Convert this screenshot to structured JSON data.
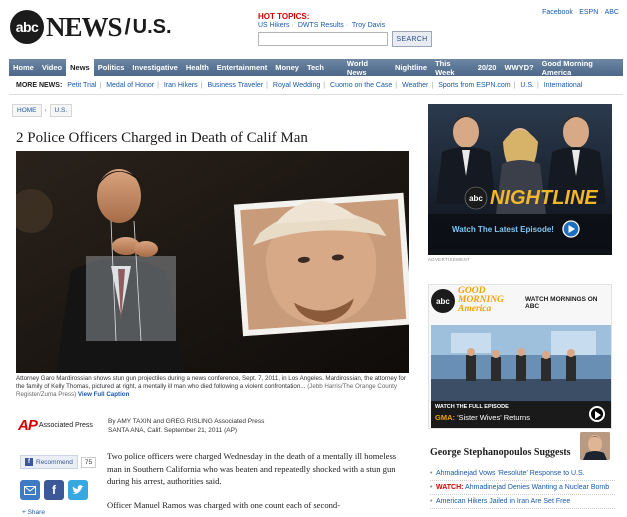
{
  "header": {
    "logo_abc": "abc",
    "logo_news": "NEWS",
    "logo_sep": "/",
    "logo_section": "U.S.",
    "hot_topics_label": "HOT TOPICS:",
    "hot_topics": [
      "US Hikers",
      "DWTS Results",
      "Troy Davis"
    ],
    "search_placeholder": "",
    "search_button": "SEARCH",
    "top_links": [
      "Facebook",
      "ESPN",
      "ABC"
    ]
  },
  "nav": {
    "items": [
      "Home",
      "Video",
      "News",
      "Politics",
      "Investigative",
      "Health",
      "Entertainment",
      "Money",
      "Tech"
    ],
    "active": "News",
    "right_items": [
      "World News",
      "Nightline",
      "This Week",
      "20/20",
      "WWYD?",
      "Good Morning America"
    ]
  },
  "subnav": {
    "label": "MORE NEWS:",
    "items": [
      "Petit Trial",
      "Medal of Honor",
      "Iran Hikers",
      "Business Traveler",
      "Royal Wedding",
      "Cuomo on the Case",
      "Weather",
      "Sports from ESPN.com",
      "U.S.",
      "International"
    ]
  },
  "breadcrumb": [
    "HOME",
    "U.S."
  ],
  "article": {
    "title": "2 Police Officers Charged in Death of Calif Man",
    "caption": "Attorney Garo Mardirossian shows stun gun projectiles during a news conference, Sept. 7, 2011, in Los Angeles. Mardirossian, the attorney for the family of Kelly Thomas, pictured at right, a mentally ill man who died following a violent confrontation...",
    "caption_credit": "(Jebb Harris/The Orange County Register/Zuma Press)",
    "view_caption": "View Full Caption",
    "ap_mark": "AP",
    "ap_text": "Associated Press",
    "byline": "By AMY TAXIN and GREG RISLING Associated Press",
    "dateline": "SANTA ANA, Calif. September 21, 2011 (AP)",
    "paragraph1": "Two police officers were charged Wednesday in the death of a mentally ill homeless man in Southern California who was beaten and repeatedly shocked with a stun gun during his arrest, authorities said.",
    "paragraph2": "Officer Manuel Ramos was charged with one count each of second-"
  },
  "social": {
    "recommend_label": "Recommend",
    "recommend_count": "75",
    "fb_letter": "f",
    "share_label": "+ Share"
  },
  "ads": {
    "nightline_brand": "NIGHTLINE",
    "nightline_cta": "Watch The Latest Episode!",
    "advertisement_label": "ADVERTISEMENT",
    "gma_logo": "abc",
    "gma_title_line1": "GOOD",
    "gma_title_line2": "MORNING",
    "gma_title_line3": "America",
    "gma_watch": "WATCH MORNINGS ON ABC",
    "gma_full_episode": "WATCH THE FULL EPISODE",
    "gma_show_prefix": "GMA:",
    "gma_show_title": "'Sister Wives' Returns"
  },
  "suggests": {
    "title": "George Stephanopoulos Suggests",
    "items": [
      {
        "prefix": "",
        "text": "Ahmadinejad Vows 'Resolute' Response to U.S."
      },
      {
        "prefix": "WATCH:",
        "text": "Ahmadinejad Denies Wanting a Nuclear Bomb"
      },
      {
        "prefix": "",
        "text": "American Hikers Jailed in Iran Are Set Free"
      }
    ]
  },
  "colors": {
    "nav_bg": "#5a7595",
    "link": "#1a5aa8",
    "hot_red": "#d40000",
    "gma_orange": "#f0a300"
  }
}
